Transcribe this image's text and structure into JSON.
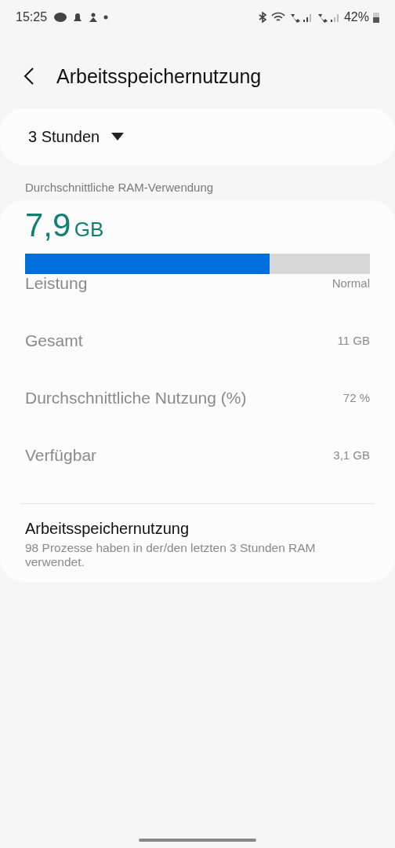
{
  "status_bar": {
    "time": "15:25",
    "battery": "42%"
  },
  "header": {
    "title": "Arbeitsspeichernutzung"
  },
  "period": {
    "value": "3 Stunden"
  },
  "section_label": "Durchschnittliche RAM-Verwendung",
  "usage": {
    "value": "7,9",
    "unit": "GB",
    "level": 0.71
  },
  "stats": [
    {
      "label": "Leistung",
      "value": "Normal"
    },
    {
      "label": "Gesamt",
      "value": "11 GB"
    },
    {
      "label": "Durchschnittliche Nutzung (%)",
      "value": "72 %"
    },
    {
      "label": "Verfügbar",
      "value": "3,1 GB"
    }
  ],
  "processes": {
    "title": "Arbeitsspeichernutzung",
    "description": "98 Prozesse haben in der/den letzten 3 Stunden RAM verwendet."
  }
}
